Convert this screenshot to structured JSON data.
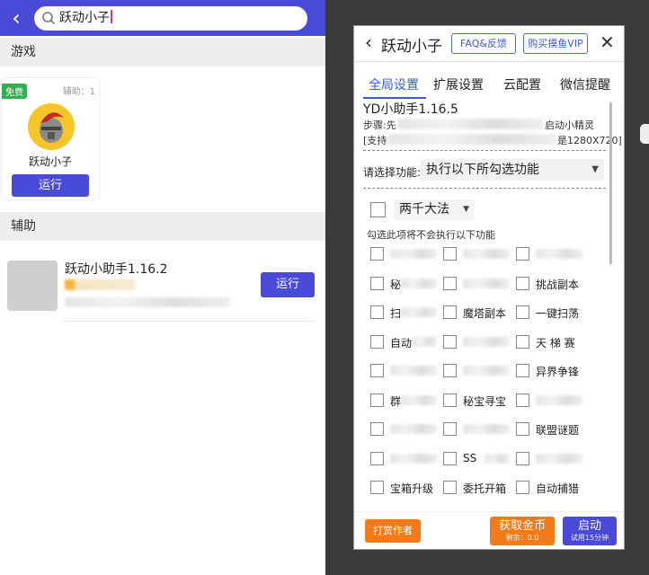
{
  "search": {
    "query": "跃动小子"
  },
  "sections": {
    "games": "游戏",
    "assist": "辅助"
  },
  "game_card": {
    "badge": "免费",
    "assist_count": "辅助：1",
    "name": "跃动小子",
    "run_label": "运行"
  },
  "assist_item": {
    "title": "跃动小助手1.16.2",
    "run_label": "运行"
  },
  "dialog": {
    "title": "跃动小子",
    "faq_label": "FAQ&反馈",
    "vip_label": "购买摸鱼VIP",
    "tabs": [
      "全局设置",
      "扩展设置",
      "云配置",
      "微信提醒"
    ],
    "version": "YD小助手1.16.5",
    "step_prefix": "步骤:先",
    "step_suffix": "启动小精灵",
    "support_prefix": "[支持",
    "support_suffix": "是1280X720]",
    "function_label": "请选择功能:",
    "function_value": "执行以下所勾选功能",
    "special_option": "两千大法",
    "special_hint": "勾选此项将不会执行以下功能",
    "options": [
      [
        "",
        "",
        ""
      ],
      [
        "秘",
        "",
        "挑战副本"
      ],
      [
        "扫",
        "魔塔副本",
        "一键扫荡"
      ],
      [
        "自动",
        "",
        "天 梯 赛"
      ],
      [
        "",
        "",
        "异界争锋"
      ],
      [
        "群",
        "秘宝寻宝",
        ""
      ],
      [
        "",
        "",
        "联盟谜题"
      ],
      [
        "",
        "SS",
        ""
      ],
      [
        "宝箱升级",
        "委托开箱",
        "自动捕猎"
      ]
    ],
    "tip_label": "打赏作者",
    "gold_label": "获取金币",
    "gold_sub": "剩余：0.0",
    "start_label": "启动",
    "start_sub": "试用15分钟"
  }
}
